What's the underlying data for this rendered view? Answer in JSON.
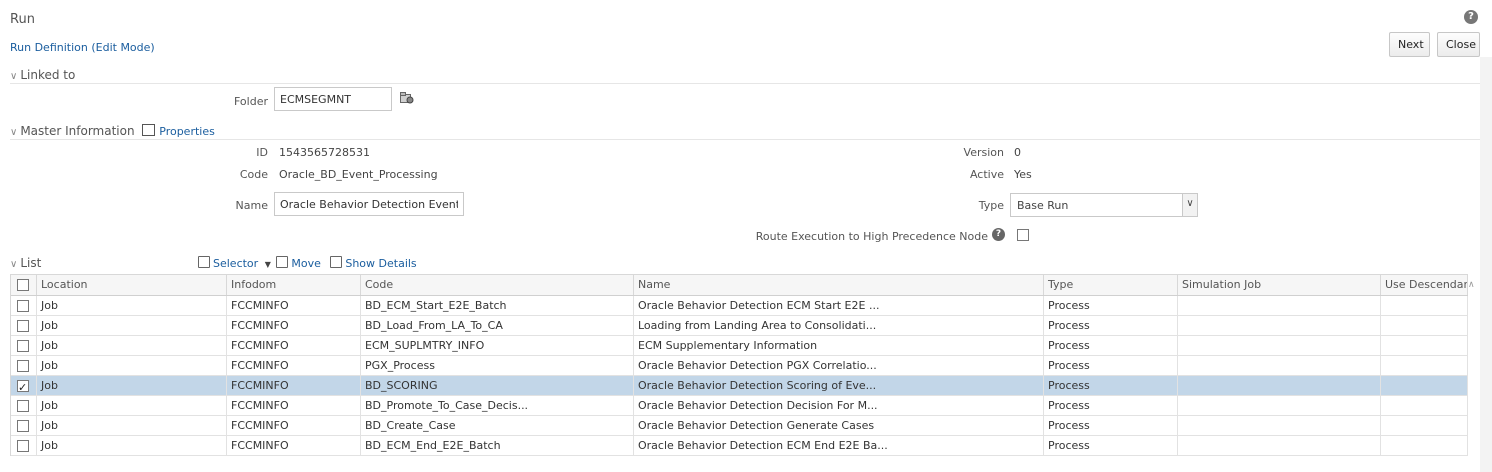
{
  "header": {
    "title": "Run",
    "subtitle": "Run Definition (Edit Mode)",
    "help": "?",
    "next_label": "Next",
    "close_label": "Close"
  },
  "linked_to": {
    "section_label": "Linked to",
    "folder_label": "Folder",
    "folder_value": "ECMSEGMNT"
  },
  "master": {
    "section_label": "Master Information",
    "properties_label": "Properties",
    "id_label": "ID",
    "id_value": "1543565728531",
    "code_label": "Code",
    "code_value": "Oracle_BD_Event_Processing",
    "name_label": "Name",
    "name_value": "Oracle Behavior Detection Event Proce",
    "version_label": "Version",
    "version_value": "0",
    "active_label": "Active",
    "active_value": "Yes",
    "type_label": "Type",
    "type_value": "Base Run",
    "route_label": "Route Execution to High Precedence Node"
  },
  "list": {
    "section_label": "List",
    "selector_label": "Selector",
    "move_label": "Move",
    "show_details_label": "Show Details",
    "columns": [
      "Location",
      "Infodom",
      "Code",
      "Name",
      "Type",
      "Simulation Job",
      "Use Descendants"
    ],
    "rows": [
      {
        "checked": false,
        "location": "Job",
        "infodom": "FCCMINFO",
        "code": "BD_ECM_Start_E2E_Batch",
        "name": "Oracle Behavior Detection ECM Start E2E ...",
        "type": "Process"
      },
      {
        "checked": false,
        "location": "Job",
        "infodom": "FCCMINFO",
        "code": "BD_Load_From_LA_To_CA",
        "name": "Loading from Landing Area to Consolidati...",
        "type": "Process"
      },
      {
        "checked": false,
        "location": "Job",
        "infodom": "FCCMINFO",
        "code": "ECM_SUPLMTRY_INFO",
        "name": "ECM Supplementary Information",
        "type": "Process"
      },
      {
        "checked": false,
        "location": "Job",
        "infodom": "FCCMINFO",
        "code": "PGX_Process",
        "name": "Oracle Behavior Detection PGX Correlatio...",
        "type": "Process"
      },
      {
        "checked": true,
        "location": "Job",
        "infodom": "FCCMINFO",
        "code": "BD_SCORING",
        "name": "Oracle Behavior Detection Scoring of Eve...",
        "type": "Process"
      },
      {
        "checked": false,
        "location": "Job",
        "infodom": "FCCMINFO",
        "code": "BD_Promote_To_Case_Decis...",
        "name": "Oracle Behavior Detection Decision For M...",
        "type": "Process"
      },
      {
        "checked": false,
        "location": "Job",
        "infodom": "FCCMINFO",
        "code": "BD_Create_Case",
        "name": "Oracle Behavior Detection Generate Cases",
        "type": "Process"
      },
      {
        "checked": false,
        "location": "Job",
        "infodom": "FCCMINFO",
        "code": "BD_ECM_End_E2E_Batch",
        "name": "Oracle Behavior Detection ECM End E2E Ba...",
        "type": "Process"
      }
    ]
  }
}
